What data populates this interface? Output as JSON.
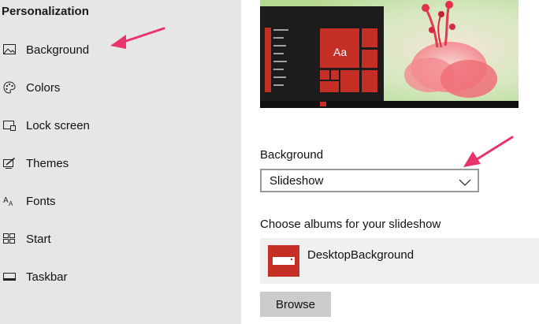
{
  "sidebar": {
    "title": "Personalization",
    "items": [
      {
        "label": "Background",
        "icon": "picture-icon"
      },
      {
        "label": "Colors",
        "icon": "palette-icon"
      },
      {
        "label": "Lock screen",
        "icon": "lock-screen-icon"
      },
      {
        "label": "Themes",
        "icon": "themes-icon"
      },
      {
        "label": "Fonts",
        "icon": "fonts-icon"
      },
      {
        "label": "Start",
        "icon": "start-icon"
      },
      {
        "label": "Taskbar",
        "icon": "taskbar-icon"
      }
    ]
  },
  "main": {
    "preview": {
      "tile_text": "Aa"
    },
    "background_label": "Background",
    "background_dropdown": {
      "value": "Slideshow"
    },
    "albums_label": "Choose albums for your slideshow",
    "album": {
      "name": "DesktopBackground"
    },
    "browse_label": "Browse"
  },
  "colors": {
    "accent": "#c62f25",
    "sidebar_bg": "#e6e6e6",
    "annotation_arrow": "#e8336b"
  }
}
